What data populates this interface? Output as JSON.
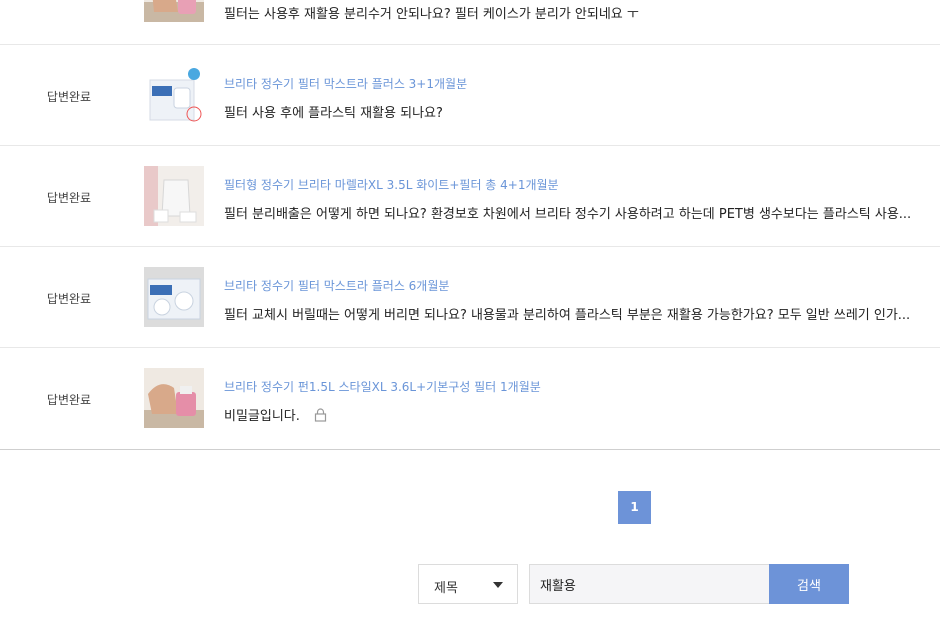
{
  "qna_list": [
    {
      "status": "",
      "product": "",
      "question": "필터는 사용후 재활용 분리수거 안되나요? 필터 케이스가 분리가 안되네요 ㅜ",
      "thumb": "hand-pitcher"
    },
    {
      "status": "답변완료",
      "product": "브리타 정수기 필터 막스트라 플러스 3+1개월분",
      "question": "필터 사용 후에 플라스틱 재활용 되나요?",
      "thumb": "filter-box"
    },
    {
      "status": "답변완료",
      "product": "필터형 정수기 브리타 마렐라XL 3.5L 화이트+필터 총 4+1개월분",
      "question": "필터 분리배출은 어떻게 하면 되나요? 환경보호 차원에서 브리타 정수기 사용하려고 하는데 PET병 생수보다는 플라스틱 사용...",
      "thumb": "pitcher-set"
    },
    {
      "status": "답변완료",
      "product": "브리타 정수기 필터 막스트라 플러스 6개월분",
      "question": "필터 교체시 버릴때는 어떻게 버리면 되나요? 내용물과 분리하여 플라스틱 부분은 재활용 가능한가요? 모두 일반 쓰레기 인가...",
      "thumb": "filter-box"
    },
    {
      "status": "답변완료",
      "product": "브리타 정수기 펀1.5L 스타일XL 3.6L+기본구성 필터 1개월분",
      "question": "비밀글입니다.",
      "thumb": "hand-pitcher",
      "locked": true
    }
  ],
  "pagination": {
    "current_page": "1"
  },
  "search": {
    "field_selected": "제목",
    "query": "재활용",
    "button_label": "검색"
  },
  "icons": {
    "lock": "lock-icon",
    "dropdown": "chevron-down-icon"
  },
  "colors": {
    "accent": "#6d93d8",
    "product_link": "#6a95d8"
  }
}
